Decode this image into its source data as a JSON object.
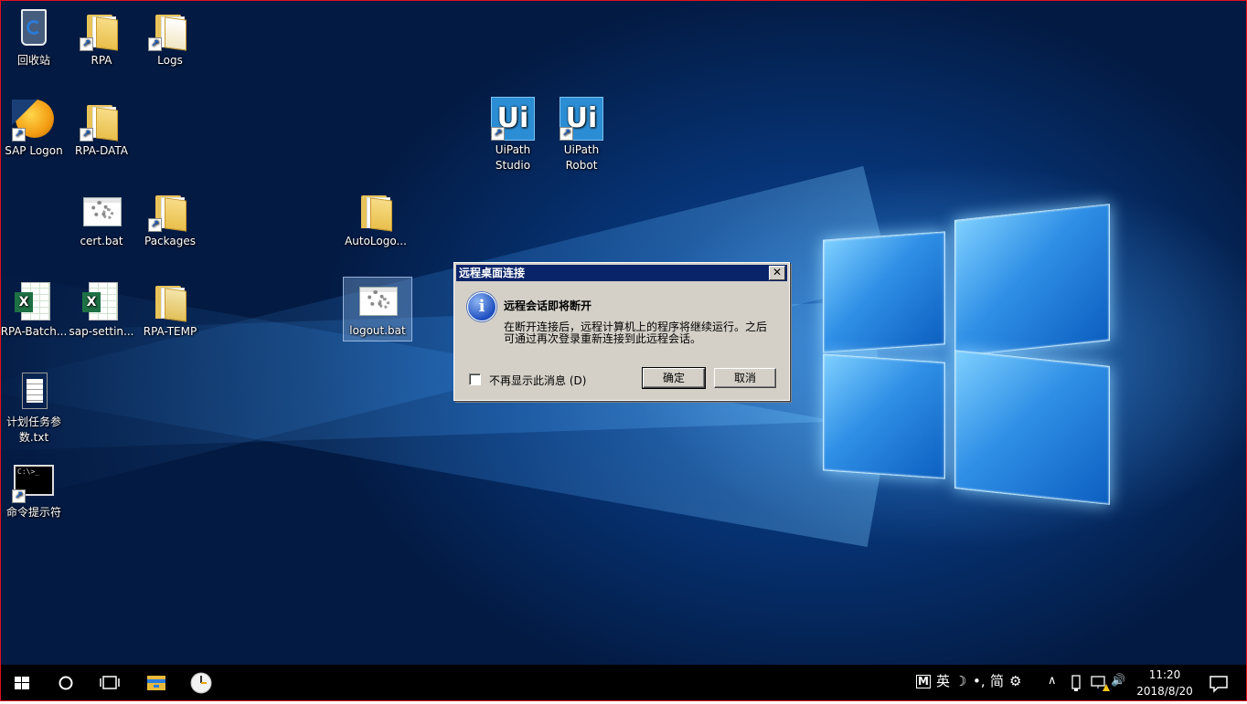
{
  "desktop": {
    "icons": [
      {
        "label": "回收站"
      },
      {
        "label": "RPA"
      },
      {
        "label": "Logs"
      },
      {
        "label": "SAP Logon"
      },
      {
        "label": "RPA-DATA"
      },
      {
        "label": "UiPath Studio"
      },
      {
        "label": "UiPath Robot"
      },
      {
        "label": "cert.bat"
      },
      {
        "label": "Packages"
      },
      {
        "label": "AutoLogo..."
      },
      {
        "label": "RPA-Batch..."
      },
      {
        "label": "sap-settin..."
      },
      {
        "label": "RPA-TEMP"
      },
      {
        "label": "logout.bat"
      },
      {
        "label": "计划任务参数.txt"
      },
      {
        "label": "命令提示符"
      }
    ],
    "cmd_prompt_text": "C:\\>_",
    "uipath_logo": "Ui"
  },
  "dialog": {
    "title": "远程桌面连接",
    "close": "✕",
    "info_glyph": "i",
    "heading": "远程会话即将断开",
    "body": "在断开连接后，远程计算机上的程序将继续运行。之后可通过再次登录重新连接到此远程会话。",
    "checkbox_label": "不再显示此消息 (D)",
    "ok": "确定",
    "cancel": "取消"
  },
  "taskbar": {
    "tray": {
      "ime_m": "M",
      "ime_lang": "英",
      "ime_moon": "☽",
      "ime_punct": "•,",
      "ime_simp": "简",
      "ime_settings": "⚙",
      "chevron": "∧",
      "volume": "🔊",
      "time": "11:20",
      "date": "2018/8/20"
    }
  }
}
